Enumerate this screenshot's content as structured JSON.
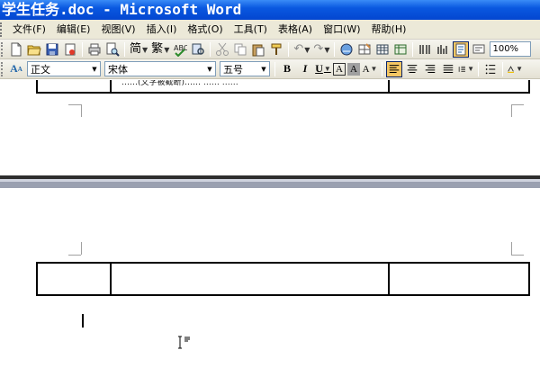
{
  "window": {
    "title": "学生任务.doc - Microsoft Word"
  },
  "menu": {
    "items": [
      {
        "label": "文件(F)",
        "name": "menu-file"
      },
      {
        "label": "编辑(E)",
        "name": "menu-edit"
      },
      {
        "label": "视图(V)",
        "name": "menu-view"
      },
      {
        "label": "插入(I)",
        "name": "menu-insert"
      },
      {
        "label": "格式(O)",
        "name": "menu-format"
      },
      {
        "label": "工具(T)",
        "name": "menu-tools"
      },
      {
        "label": "表格(A)",
        "name": "menu-table"
      },
      {
        "label": "窗口(W)",
        "name": "menu-window"
      },
      {
        "label": "帮助(H)",
        "name": "menu-help"
      }
    ]
  },
  "standard_toolbar": {
    "zoom": "100%",
    "simplified_label": "简",
    "traditional_label": "繁",
    "icons": [
      "new-icon",
      "open-icon",
      "save-icon",
      "permission-icon",
      "print-icon",
      "print-preview-icon",
      "simplified-chinese-icon",
      "traditional-chinese-icon",
      "spelling-icon",
      "research-icon",
      "cut-icon",
      "copy-icon",
      "paste-icon",
      "format-painter-icon",
      "undo-icon",
      "redo-icon",
      "hyperlink-icon",
      "tables-borders-icon",
      "insert-table-icon",
      "insert-excel-icon",
      "columns-icon",
      "drawing-icon",
      "document-map-icon",
      "show-hide-icon"
    ]
  },
  "format_toolbar": {
    "style": "正文",
    "font": "宋体",
    "size": "五号",
    "bold": "B",
    "italic": "I",
    "underline": "U",
    "char_border": "A",
    "char_shading": "A",
    "highlight": "A"
  },
  "document": {
    "garbled_text": "……(文字被截断)……  ……  ……"
  },
  "colors": {
    "titlebar": "#0a58e0",
    "toolbar": "#ece9d8",
    "selected_button": "#f5c763",
    "page_break": "#2e2e2e"
  }
}
